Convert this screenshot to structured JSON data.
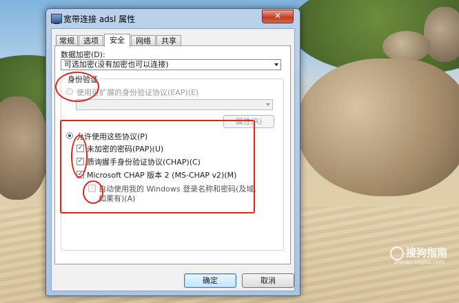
{
  "window": {
    "title": "宽带连接 adsl 属性",
    "close_label": "✕"
  },
  "tabs": [
    "常规",
    "选项",
    "安全",
    "网络",
    "共享"
  ],
  "active_tab": "安全",
  "security": {
    "encryption_label": "数据加密(D):",
    "encryption_value": "可选加密(没有加密也可以连接)",
    "auth_group_label": "身份验证",
    "eap_radio_label": "使用可扩展的身份验证协议(EAP)(E)",
    "eap_select_value": "",
    "properties_button": "属性(R)",
    "allow_protocols_label": "允许使用这些协议(P)",
    "protocols": [
      {
        "label": "未加密的密码(PAP)(U)",
        "checked": true
      },
      {
        "label": "质询握手身份验证协议(CHAP)(C)",
        "checked": true
      },
      {
        "label": "Microsoft CHAP 版本 2 (MS-CHAP v2)(M)",
        "checked": true
      }
    ],
    "auto_windows_logon_line1": "自动使用我的 Windows 登录名称和密码(及域,",
    "auto_windows_logon_line2": "如果有)(A)"
  },
  "buttons": {
    "ok": "确定",
    "cancel": "取消"
  },
  "watermark": {
    "brand": "搜狗指南",
    "url": "zhinan.sogou.com"
  },
  "colors": {
    "annotation_red": "#e2231a",
    "close_red": "#c23b1e"
  }
}
